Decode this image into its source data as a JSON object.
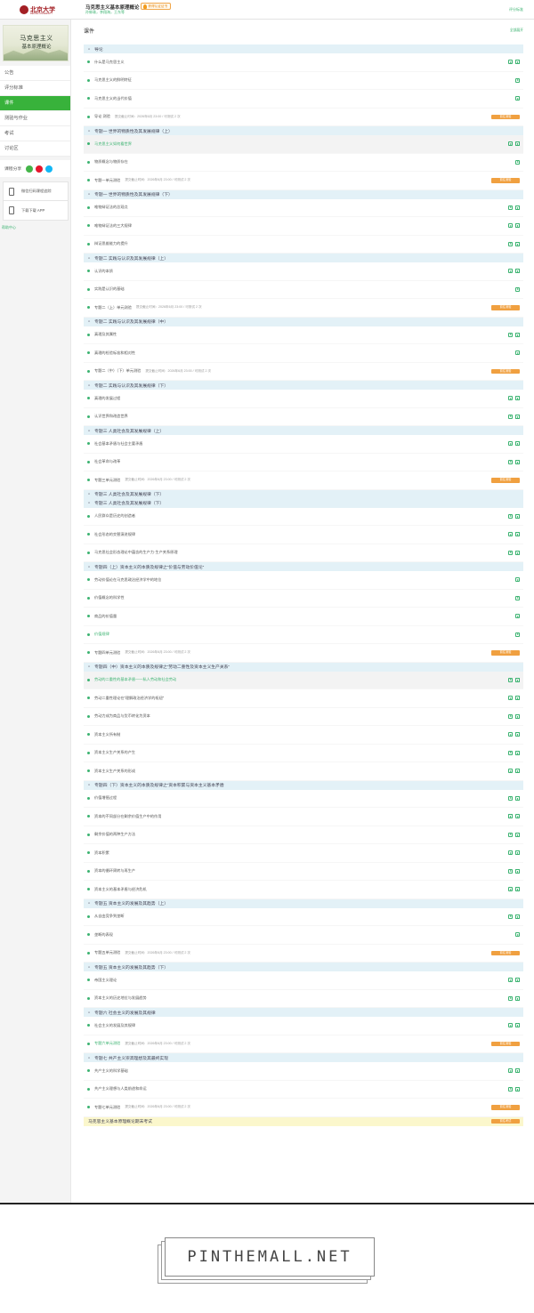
{
  "header": {
    "logo_text": "北京大学",
    "logo_sub": "PEKING UNIVERSITY",
    "course_title": "马克思主义基本原理概论",
    "teachers": "孙蚌珠，李翔海，王东等",
    "cert_label": "获得认证证书",
    "grade_link": "评分标准"
  },
  "sidebar": {
    "cover_title": "马克思主义",
    "cover_subtitle": "基本原理概论",
    "nav": [
      "公告",
      "评分标准",
      "课件",
      "测验与作业",
      "考试",
      "讨论区"
    ],
    "active_index": 2,
    "share_label": "课程分享",
    "qr_label": "微信扫码课程追踪",
    "app_label": "下载下载 APP",
    "help_link": "帮助中心"
  },
  "main": {
    "title": "课件",
    "expand_link": "全部展开",
    "test_button": "前往测验",
    "final_exam_button": "前往考试",
    "units": [
      {
        "title": "导论",
        "items": [
          {
            "name": "什么是马克思主义",
            "icons": [
              "play",
              "doc"
            ]
          },
          {
            "name": "马克思主义的鲜明特征",
            "icons": [
              "play"
            ]
          },
          {
            "name": "马克思主义的当代价值",
            "icons": [
              "play"
            ]
          },
          {
            "name": "导论 测验",
            "meta": "提交截止时间：2026年6月 23:00 / 可测试 2 次",
            "test": true
          }
        ]
      },
      {
        "title": "专题一 世界的物质性及其发展规律（上）",
        "items": [
          {
            "name": "马克思主义如何看世界",
            "icons": [
              "play",
              "doc"
            ],
            "hl": true
          },
          {
            "name": "物质概念与物质存在",
            "icons": [
              "play"
            ]
          },
          {
            "name": "专题一单元测验",
            "meta": "提交截止时间：2026年6月 23:00 / 可测试 2 次",
            "test": true
          }
        ]
      },
      {
        "title": "专题一 世界的物质性及其发展规律（下）",
        "items": [
          {
            "name": "唯物辩证法的总观点",
            "icons": [
              "play",
              "doc"
            ]
          },
          {
            "name": "唯物辩证法的三大规律",
            "icons": [
              "play",
              "doc"
            ]
          },
          {
            "name": "辩证思维能力的提升",
            "icons": [
              "play",
              "doc"
            ]
          }
        ]
      },
      {
        "title": "专题二 实践与认识及其发展规律（上）",
        "items": [
          {
            "name": "认识的本质",
            "icons": [
              "play",
              "doc"
            ]
          },
          {
            "name": "实践是认识的基础",
            "icons": [
              "play"
            ]
          },
          {
            "name": "专题二（上）单元测验",
            "meta": "提交截止时间：2026年6月 23:00 / 可测试 2 次",
            "test": true
          }
        ]
      },
      {
        "title": "专题二 实践与认识及其发展规律（中）",
        "items": [
          {
            "name": "真理及其属性",
            "icons": [
              "play",
              "doc"
            ]
          },
          {
            "name": "真理的检验标准和相对性",
            "icons": [
              "play"
            ]
          },
          {
            "name": "专题二（中）（下）单元测验",
            "meta": "提交截止时间：2026年6月 23:00 / 可测试 2 次",
            "test": true
          }
        ]
      },
      {
        "title": "专题二 实践与认识及其发展规律（下）",
        "items": [
          {
            "name": "真理的发展过程",
            "icons": [
              "play",
              "doc"
            ]
          },
          {
            "name": "认识世界和改造世界",
            "icons": [
              "play",
              "doc"
            ]
          }
        ]
      },
      {
        "title": "专题三 人类社会及其发展规律（上）",
        "items": [
          {
            "name": "社会基本矛盾与社会主要矛盾",
            "icons": [
              "play",
              "doc"
            ]
          },
          {
            "name": "社会革命与改革",
            "icons": [
              "play",
              "doc"
            ]
          },
          {
            "name": "专题三单元测验",
            "meta": "提交截止时间：2026年6月 23:00 / 可测试 2 次",
            "test": true
          }
        ]
      },
      {
        "title": "专题三 人类社会及其发展规律（下）",
        "items": []
      },
      {
        "title": "专题三 人类社会及其发展规律（下）",
        "items": [
          {
            "name": "人民群众是历史的创造者",
            "icons": [
              "play",
              "doc"
            ]
          },
          {
            "name": "社会形态的交替演进规律",
            "icons": [
              "play",
              "doc"
            ]
          },
          {
            "name": "马克思社会形态理论中蕴含的生产力·生产关系原理",
            "icons": [
              "play",
              "doc"
            ]
          }
        ]
      },
      {
        "title": "专题四（上）资本主义的本质及规律之“价值与劳动价值论”",
        "items": [
          {
            "name": "劳动价值论在马克思政治经济学中的地位",
            "icons": [
              "play"
            ]
          },
          {
            "name": "价值概念的科学性",
            "icons": [
              "play"
            ]
          },
          {
            "name": "商品的价值量",
            "icons": [
              "play"
            ]
          },
          {
            "name": "价值规律",
            "icons": [
              "play"
            ],
            "green": true
          },
          {
            "name": "专题四单元测验",
            "meta": "提交截止时间：2026年6月 23:00 / 可测试 2 次",
            "test": true
          }
        ]
      },
      {
        "title": "专题四（中）资本主义的本质及规律之“劳动二重性及资本主义生产关系”",
        "items": [
          {
            "name": "劳动的二重性的基本矛盾——私人劳动和社会劳动",
            "icons": [
              "play",
              "doc"
            ],
            "hl": true
          },
          {
            "name": "劳动二重性理论在“理解政治经济学的枢纽”",
            "icons": [
              "play",
              "doc"
            ]
          },
          {
            "name": "劳动力成为商品与货币转化为资本",
            "icons": [
              "play",
              "doc"
            ]
          },
          {
            "name": "资本主义所有制",
            "icons": [
              "play",
              "doc"
            ]
          },
          {
            "name": "资本主义生产关系的产生",
            "icons": [
              "play",
              "doc"
            ]
          },
          {
            "name": "资本主义生产关系的形成",
            "icons": [
              "play",
              "doc"
            ]
          }
        ]
      },
      {
        "title": "专题四（下）资本主义的本质及规律之“资本积累与资本主义基本矛盾",
        "items": [
          {
            "name": "价值增殖过程",
            "icons": [
              "play",
              "doc"
            ]
          },
          {
            "name": "资本的不同部分在剩余价值生产中的作用",
            "icons": [
              "doc",
              "play"
            ]
          },
          {
            "name": "剩余价值的两种生产方法",
            "icons": [
              "play",
              "doc"
            ]
          },
          {
            "name": "资本积累",
            "icons": [
              "play",
              "doc"
            ]
          },
          {
            "name": "资本的循环周转与再生产",
            "icons": [
              "play",
              "doc"
            ]
          },
          {
            "name": "资本主义的基本矛盾与经济危机",
            "icons": [
              "play",
              "doc"
            ]
          }
        ]
      },
      {
        "title": "专题五 资本主义的发展及其趋势（上）",
        "items": [
          {
            "name": "从自由竞争到垄断",
            "icons": [
              "play",
              "doc"
            ]
          },
          {
            "name": "垄断的表现",
            "icons": [
              "play"
            ]
          },
          {
            "name": "专题五单元测验",
            "meta": "提交截止时间：2026年6月 23:00 / 可测试 2 次",
            "test": true
          }
        ]
      },
      {
        "title": "专题五 资本主义的发展及其趋势（下）",
        "items": [
          {
            "name": "帝国主义理论",
            "icons": [
              "play",
              "doc"
            ]
          },
          {
            "name": "资本主义的历史地位与发展趋势",
            "icons": [
              "play",
              "doc"
            ]
          }
        ]
      },
      {
        "title": "专题六 社会主义的发展及其规律",
        "items": [
          {
            "name": "社会主义的发展及其规律",
            "icons": [
              "play",
              "doc"
            ]
          },
          {
            "name": "专题六单元测验",
            "meta": "提交截止时间：2026年6月 23:00 / 可测试 2 次",
            "test": true,
            "green": true
          }
        ]
      },
      {
        "title": "专题七 共产主义崇高理想及其最终实现",
        "items": [
          {
            "name": "共产主义的科学基础",
            "icons": [
              "play",
              "doc"
            ]
          },
          {
            "name": "共产主义理想与人类前途和命运",
            "icons": [
              "play",
              "doc"
            ]
          },
          {
            "name": "专题七单元测验",
            "meta": "提交截止时间：2026年6月 23:00 / 可测试 2 次",
            "test": true
          }
        ]
      }
    ],
    "final_exam_title": "马克思主义基本原理概论期末考试"
  },
  "watermark": {
    "text": "PINTHEMALL.NET"
  }
}
